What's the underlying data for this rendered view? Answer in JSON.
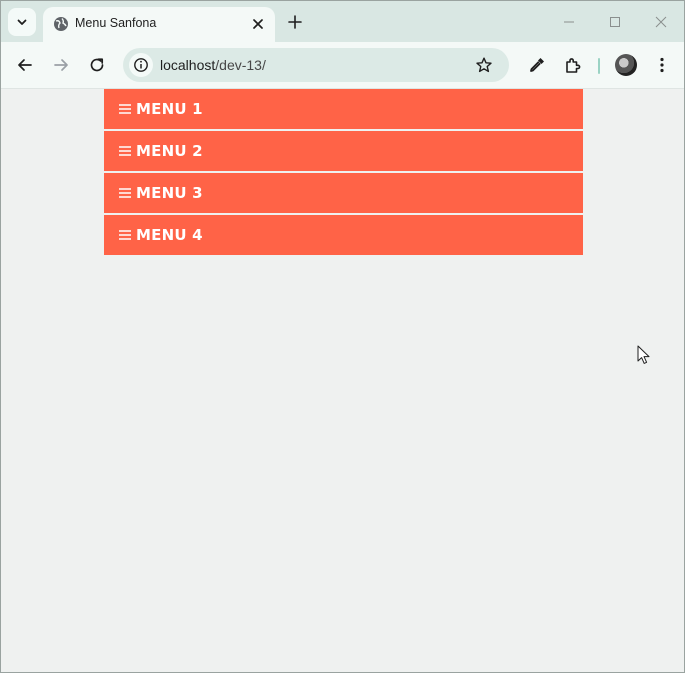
{
  "browser": {
    "tab": {
      "title": "Menu Sanfona"
    },
    "address": {
      "host": "localhost",
      "path": "/dev-13/"
    }
  },
  "accordion": {
    "items": [
      {
        "label": "MENU 1"
      },
      {
        "label": "MENU 2"
      },
      {
        "label": "MENU 3"
      },
      {
        "label": "MENU 4"
      }
    ]
  },
  "colors": {
    "accent": "#ff6347",
    "background": "#eff1f0",
    "tabstrip": "#d9e7e3"
  },
  "icons": [
    "chevron-down-icon",
    "globe-icon",
    "close-icon",
    "plus-icon",
    "minimize-icon",
    "maximize-icon",
    "window-close-icon",
    "back-icon",
    "forward-icon",
    "reload-icon",
    "info-icon",
    "star-icon",
    "eyedropper-icon",
    "extensions-icon",
    "profile-avatar",
    "more-icon",
    "hamburger-icon",
    "mouse-cursor-icon"
  ]
}
